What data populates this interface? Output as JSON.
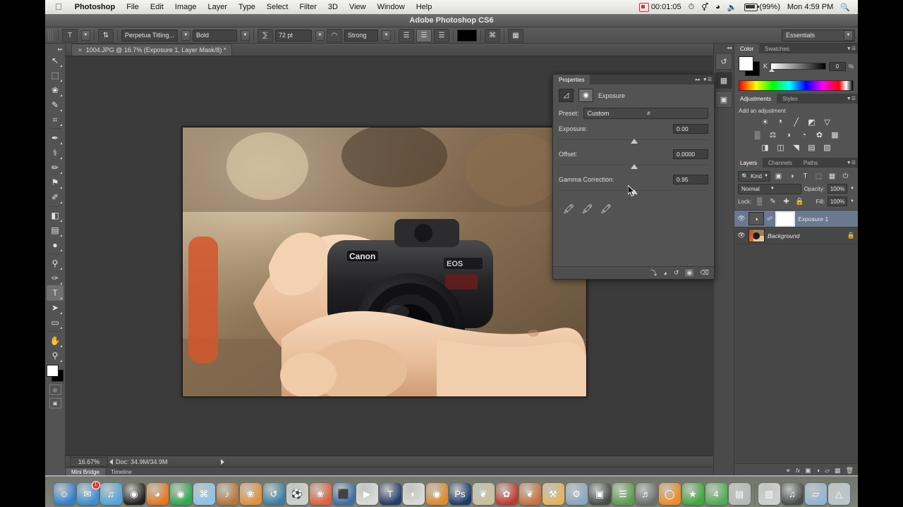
{
  "menubar": {
    "apple": "",
    "items": [
      "Photoshop",
      "File",
      "Edit",
      "Image",
      "Layer",
      "Type",
      "Select",
      "Filter",
      "3D",
      "View",
      "Window",
      "Help"
    ],
    "record_time": "00:01:05",
    "battery": "(99%)",
    "clock": "Mon 4:59 PM",
    "search_icon": "search-icon"
  },
  "window": {
    "title": "Adobe Photoshop CS6"
  },
  "options_bar": {
    "tool_icon": "type-tool-icon",
    "orientation_icon": "text-orientation-icon",
    "font_family": "Perpetua Titling...",
    "font_style": "Bold",
    "size_icon": "font-size-icon",
    "font_size": "72 pt",
    "aa_icon": "anti-alias-icon",
    "anti_alias": "Strong",
    "align_left": "align-left-icon",
    "align_center": "align-center-icon",
    "align_right": "align-right-icon",
    "color_swatch": "#000000",
    "warp_icon": "warp-text-icon",
    "panels_icon": "character-panel-icon",
    "workspace": "Essentials"
  },
  "toolbar": {
    "tools": [
      {
        "name": "move-tool",
        "glyph": "↖",
        "selected": false
      },
      {
        "name": "marquee-tool",
        "glyph": "⬚",
        "selected": false
      },
      {
        "name": "lasso-tool",
        "glyph": "❀",
        "selected": false
      },
      {
        "name": "quick-selection-tool",
        "glyph": "✎",
        "selected": false
      },
      {
        "name": "crop-tool",
        "glyph": "⌗",
        "selected": false
      },
      {
        "name": "eyedropper-tool",
        "glyph": "✒",
        "selected": false
      },
      {
        "name": "spot-healing-tool",
        "glyph": "⚕",
        "selected": false
      },
      {
        "name": "brush-tool",
        "glyph": "✏",
        "selected": false
      },
      {
        "name": "clone-stamp-tool",
        "glyph": "⚑",
        "selected": false
      },
      {
        "name": "history-brush-tool",
        "glyph": "✐",
        "selected": false
      },
      {
        "name": "eraser-tool",
        "glyph": "◧",
        "selected": false
      },
      {
        "name": "gradient-tool",
        "glyph": "▤",
        "selected": false
      },
      {
        "name": "blur-tool",
        "glyph": "●",
        "selected": false
      },
      {
        "name": "dodge-tool",
        "glyph": "⚲",
        "selected": false
      },
      {
        "name": "pen-tool",
        "glyph": "✑",
        "selected": false
      },
      {
        "name": "type-tool",
        "glyph": "T",
        "selected": true
      },
      {
        "name": "path-selection-tool",
        "glyph": "➤",
        "selected": false
      },
      {
        "name": "rectangle-shape-tool",
        "glyph": "▭",
        "selected": false
      },
      {
        "name": "hand-tool",
        "glyph": "✋",
        "selected": false
      },
      {
        "name": "zoom-tool",
        "glyph": "⚲",
        "selected": false
      }
    ],
    "foreground_color": "#ffffff",
    "background_color": "#000000",
    "quickmask_icon": "quick-mask-icon",
    "screenmode_icon": "screen-mode-icon"
  },
  "document": {
    "tab_title": "1004.JPG @ 16.7% (Exposure 1, Layer Mask/8) *",
    "close_icon": "close-icon",
    "zoom_level": "16.67%",
    "doc_size": "Doc: 34.9M/34.9M",
    "bottom_tabs": [
      {
        "label": "Mini Bridge",
        "active": true
      },
      {
        "label": "Timeline",
        "active": false
      }
    ]
  },
  "properties": {
    "tab_label": "Properties",
    "collapse_icon": "collapse-icon",
    "menu_icon": "panel-menu-icon",
    "adjustment_icon": "exposure-adjust-icon",
    "mask_icon": "layer-mask-icon",
    "title": "Exposure",
    "preset_label": "Preset:",
    "preset_value": "Custom",
    "sliders": [
      {
        "label": "Exposure:",
        "value": "0.00",
        "pos": 50
      },
      {
        "label": "Offset:",
        "value": "0.0000",
        "pos": 50
      },
      {
        "label": "Gamma Correction:",
        "value": "0.95",
        "pos": 50
      }
    ],
    "eyedroppers": [
      {
        "name": "set-black-point-eyedropper",
        "glyph": "✒"
      },
      {
        "name": "set-gray-point-eyedropper",
        "glyph": "✒"
      },
      {
        "name": "set-white-point-eyedropper",
        "glyph": "✒"
      }
    ],
    "footer_icons": [
      {
        "name": "clip-to-layer-icon",
        "glyph": "⤵"
      },
      {
        "name": "view-previous-state-icon",
        "glyph": "◑"
      },
      {
        "name": "reset-adjustment-icon",
        "glyph": "↺"
      },
      {
        "name": "toggle-visibility-icon",
        "glyph": "◉",
        "active": true
      },
      {
        "name": "delete-adjustment-icon",
        "glyph": "⌧"
      }
    ]
  },
  "rail": {
    "items": [
      {
        "name": "history-panel-icon",
        "glyph": "↺",
        "active": false
      },
      {
        "name": "mini-bridge-panel-icon",
        "glyph": "⊞",
        "active": true
      },
      {
        "name": "3d-panel-icon",
        "glyph": "⬜",
        "active": false
      }
    ]
  },
  "color_panel": {
    "tabs": [
      {
        "label": "Color",
        "active": true
      },
      {
        "label": "Swatches",
        "active": false
      }
    ],
    "menu_icon": "panel-menu-icon",
    "foreground_color": "#ffffff",
    "background_color": "#000000",
    "channel_label": "K",
    "channel_value": "0",
    "channel_unit": "%"
  },
  "adjustments_panel": {
    "tabs": [
      {
        "label": "Adjustments",
        "active": true
      },
      {
        "label": "Styles",
        "active": false
      }
    ],
    "heading": "Add an adjustment",
    "row1": [
      {
        "name": "brightness-contrast-icon",
        "glyph": "☀"
      },
      {
        "name": "levels-icon",
        "glyph": "ᵜ"
      },
      {
        "name": "curves-icon",
        "glyph": "╱"
      },
      {
        "name": "exposure-icon",
        "glyph": "◩"
      },
      {
        "name": "vibrance-icon",
        "glyph": "▽"
      }
    ],
    "row2": [
      {
        "name": "hue-saturation-icon",
        "glyph": "▒"
      },
      {
        "name": "color-balance-icon",
        "glyph": "⚖"
      },
      {
        "name": "black-white-icon",
        "glyph": "◑"
      },
      {
        "name": "photo-filter-icon",
        "glyph": "◔"
      },
      {
        "name": "channel-mixer-icon",
        "glyph": "✿"
      },
      {
        "name": "color-lookup-icon",
        "glyph": "▦"
      }
    ],
    "row3": [
      {
        "name": "invert-icon",
        "glyph": "◨"
      },
      {
        "name": "posterize-icon",
        "glyph": "◫"
      },
      {
        "name": "threshold-icon",
        "glyph": "◥"
      },
      {
        "name": "gradient-map-icon",
        "glyph": "▤"
      },
      {
        "name": "selective-color-icon",
        "glyph": "▧"
      }
    ]
  },
  "layers_panel": {
    "tabs": [
      {
        "label": "Layers",
        "active": true
      },
      {
        "label": "Channels",
        "active": false
      },
      {
        "label": "Paths",
        "active": false
      }
    ],
    "menu_icon": "panel-menu-icon",
    "filter_label": "Kind",
    "filter_search_icon": "search-icon",
    "filter_icons": [
      {
        "name": "filter-pixel-layers-icon",
        "glyph": "▣"
      },
      {
        "name": "filter-adjustment-layers-icon",
        "glyph": "◑"
      },
      {
        "name": "filter-type-layers-icon",
        "glyph": "T"
      },
      {
        "name": "filter-shape-layers-icon",
        "glyph": "⬚"
      },
      {
        "name": "filter-smart-objects-icon",
        "glyph": "⊞"
      }
    ],
    "filter_toggle_icon": "filter-power-icon",
    "blend_mode": "Normal",
    "opacity_label": "Opacity:",
    "opacity_value": "100%",
    "lock_label": "Lock:",
    "lock_icons": [
      {
        "name": "lock-transparent-pixels-icon",
        "glyph": "▒"
      },
      {
        "name": "lock-image-pixels-icon",
        "glyph": "✎"
      },
      {
        "name": "lock-position-icon",
        "glyph": "✢"
      },
      {
        "name": "lock-all-icon",
        "glyph": "ὑ2"
      }
    ],
    "fill_label": "Fill:",
    "fill_value": "100%",
    "layers": [
      {
        "name": "Exposure 1",
        "selected": true,
        "type": "adjustment",
        "visible": true,
        "locked": false,
        "has_mask": true
      },
      {
        "name": "Background",
        "selected": false,
        "type": "image",
        "visible": true,
        "locked": true,
        "has_mask": false
      }
    ],
    "footer_icons": [
      {
        "name": "link-layers-icon",
        "glyph": "⚭"
      },
      {
        "name": "layer-style-icon",
        "glyph": "fx"
      },
      {
        "name": "add-layer-mask-icon",
        "glyph": "▣"
      },
      {
        "name": "new-adjustment-layer-icon",
        "glyph": "◑"
      },
      {
        "name": "new-group-icon",
        "glyph": "▱"
      },
      {
        "name": "new-layer-icon",
        "glyph": "⊞"
      },
      {
        "name": "delete-layer-icon",
        "glyph": "Ὕ1"
      }
    ]
  },
  "dock": {
    "items": [
      {
        "name": "finder",
        "glyph": "☺",
        "color": "#2f7fd0",
        "badge": null
      },
      {
        "name": "mail",
        "glyph": "✉",
        "color": "#3b8fd6",
        "badge": "1"
      },
      {
        "name": "itunes",
        "glyph": "♫",
        "color": "#4fa6dd",
        "badge": null
      },
      {
        "name": "dvd-player",
        "glyph": "◉",
        "color": "#222222",
        "badge": null
      },
      {
        "name": "firefox",
        "glyph": "◕",
        "color": "#e8761b",
        "badge": null
      },
      {
        "name": "google-chrome",
        "glyph": "◉",
        "color": "#2fa84f",
        "badge": null
      },
      {
        "name": "safari",
        "glyph": "⌘",
        "color": "#8fc2e8",
        "badge": null
      },
      {
        "name": "garageband",
        "glyph": "♪",
        "color": "#b9743a",
        "badge": null
      },
      {
        "name": "iphoto",
        "glyph": "❀",
        "color": "#e2903c",
        "badge": null
      },
      {
        "name": "time-machine",
        "glyph": "↺",
        "color": "#3a7ea8",
        "badge": null
      },
      {
        "name": "app-soccer",
        "glyph": "⚽",
        "color": "#cfcfcf",
        "badge": null
      },
      {
        "name": "photo-booth",
        "glyph": "❀",
        "color": "#e0603c",
        "badge": null
      },
      {
        "name": "imovie",
        "glyph": "⬛",
        "color": "#3b6fa8",
        "badge": null
      },
      {
        "name": "quicktime",
        "glyph": "▶",
        "color": "#dadada",
        "badge": null
      },
      {
        "name": "textedit",
        "glyph": "T",
        "color": "#243b6b",
        "badge": null
      },
      {
        "name": "pixelmator",
        "glyph": "◐",
        "color": "#d9d9d9",
        "badge": null
      },
      {
        "name": "blender",
        "glyph": "◉",
        "color": "#e08a2a",
        "badge": null
      },
      {
        "name": "photoshop",
        "glyph": "Ps",
        "color": "#1b3a6b",
        "badge": null
      },
      {
        "name": "app-rabbit",
        "glyph": "❦",
        "color": "#cbbf9e",
        "badge": null
      },
      {
        "name": "app-flamingo",
        "glyph": "✿",
        "color": "#c0392b",
        "badge": null
      },
      {
        "name": "app-ladybug",
        "glyph": "❦",
        "color": "#cc6f3c",
        "badge": null
      },
      {
        "name": "app-folder-tools",
        "glyph": "⚒",
        "color": "#e3b45e",
        "badge": null
      },
      {
        "name": "system-preferences",
        "glyph": "⚙",
        "color": "#8aa7c4",
        "badge": null
      },
      {
        "name": "app-video",
        "glyph": "▣",
        "color": "#4a4a4a",
        "badge": null
      },
      {
        "name": "app-cards",
        "glyph": "☰",
        "color": "#5a9e4a",
        "badge": null
      },
      {
        "name": "app-microphone",
        "glyph": "♬",
        "color": "#6e6e6e",
        "badge": null
      },
      {
        "name": "app-orange-ring",
        "glyph": "◯",
        "color": "#f08a1e",
        "badge": null
      },
      {
        "name": "app-star",
        "glyph": "★",
        "color": "#3fa83f",
        "badge": null
      },
      {
        "name": "app-green",
        "glyph": "4",
        "color": "#4caf50",
        "badge": null
      },
      {
        "name": "app-silver",
        "glyph": "▤",
        "color": "#b9b9b9",
        "badge": null
      },
      {
        "name": "downloads-stack",
        "glyph": "▥",
        "color": "#cfcfcf",
        "badge": null
      },
      {
        "name": "music-note-stack",
        "glyph": "♫",
        "color": "#4a4a4a",
        "badge": null
      },
      {
        "name": "documents-folder",
        "glyph": "▱",
        "color": "#8fb6d8",
        "badge": null
      },
      {
        "name": "trash",
        "glyph": "△",
        "color": "#b9c6cf",
        "badge": null
      }
    ]
  }
}
